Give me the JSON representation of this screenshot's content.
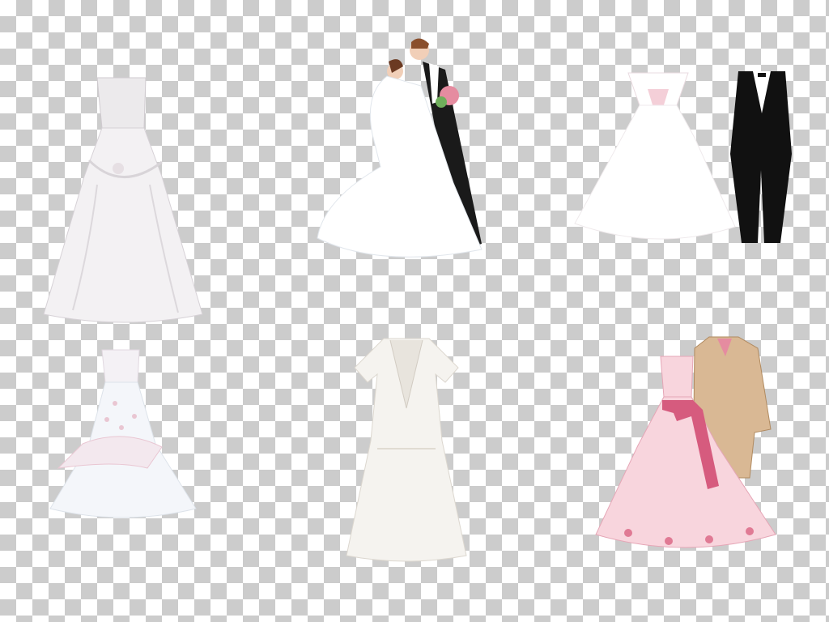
{
  "canvas": {
    "background": "transparency-checkerboard",
    "colors": {
      "checker_light": "#ffffff",
      "checker_dark": "#cccccc"
    }
  },
  "items": [
    {
      "name": "satin-strapless-ball-gown",
      "icon": "wedding-dress-icon",
      "colors": {
        "main": "#f3f1f3",
        "shade": "#d8d4d8"
      }
    },
    {
      "name": "kissing-bride-and-groom",
      "icon": "couple-icon",
      "colors": {
        "dress": "#ffffff",
        "suit": "#1a1a1a",
        "bouquet": "#e58ca0"
      }
    },
    {
      "name": "off-shoulder-gown-with-black-tuxedo",
      "icon": "gown-and-tuxedo-icon",
      "colors": {
        "dress": "#ffffff",
        "suit": "#111111"
      }
    },
    {
      "name": "embroidered-tulle-ball-gown",
      "icon": "wedding-dress-icon",
      "colors": {
        "main": "#f4f6fa",
        "accent": "#e9c6d2"
      }
    },
    {
      "name": "lace-short-sleeve-dress",
      "icon": "lace-dress-icon",
      "colors": {
        "main": "#f5f3ef"
      }
    },
    {
      "name": "watercolor-pink-gown-with-tan-suit",
      "icon": "gown-and-suit-icon",
      "colors": {
        "dress": "#f8d5dd",
        "sash": "#d65b7e",
        "suit": "#d9b894"
      }
    }
  ]
}
